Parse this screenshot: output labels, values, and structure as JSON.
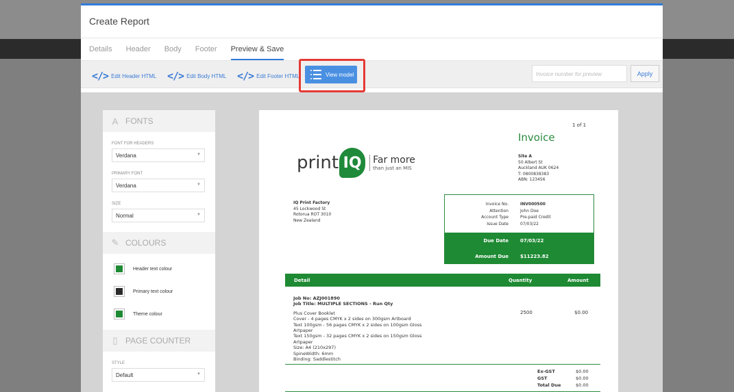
{
  "modal": {
    "title": "Create Report",
    "tabs": [
      {
        "label": "Details"
      },
      {
        "label": "Header"
      },
      {
        "label": "Body"
      },
      {
        "label": "Footer"
      },
      {
        "label": "Preview & Save",
        "active": true
      }
    ]
  },
  "toolbar": {
    "edit_header": "Edit Header HTML",
    "edit_body": "Edit Body HTML",
    "edit_footer": "Edit Footer HTML",
    "view_model": "View model",
    "invoice_placeholder": "Invoice number for preview",
    "apply": "Apply"
  },
  "panel": {
    "fonts_title": "FONTS",
    "font_headers_label": "FONT FOR HEADERS",
    "font_headers_value": "Verdana",
    "primary_font_label": "PRIMARY FONT",
    "primary_font_value": "Verdana",
    "size_label": "SIZE",
    "size_value": "Normal",
    "colours_title": "COLOURS",
    "colours": [
      {
        "label": "Header text colour",
        "color": "#1e8a33"
      },
      {
        "label": "Primary text colour",
        "color": "#2b2b2b"
      },
      {
        "label": "Theme colour",
        "color": "#1e8a33"
      }
    ],
    "page_counter_title": "PAGE COUNTER",
    "style_label": "STYLE",
    "style_value": "Default"
  },
  "document": {
    "page_number": "1 of 1",
    "title": "Invoice",
    "logo": {
      "print": "print",
      "iq": "IQ",
      "tagline_big": "Far more",
      "tagline_small": "than just an MIS"
    },
    "site": {
      "name": "Site A",
      "line1": "50 Albert St",
      "line2": "Auckland AUK 0624",
      "phone": "T: 0800838383",
      "abn": "ABN: 123456"
    },
    "customer": {
      "name": "IQ Print Factory",
      "line1": "45 Lockwood St",
      "line2": "Rotorua ROT 3010",
      "line3": "New Zealand"
    },
    "info": {
      "invoice_no_label": "Invoice No.",
      "invoice_no": "INV000500",
      "attention_label": "Attention",
      "attention": "John Doe",
      "account_type_label": "Account Type",
      "account_type": "Pre-paid Credit",
      "issue_date_label": "Issue Date",
      "issue_date": "07/03/22",
      "due_date_label": "Due Date",
      "due_date": "07/03/22",
      "amount_due_label": "Amount Due",
      "amount_due": "$11223.82"
    },
    "table": {
      "col_detail": "Detail",
      "col_quantity": "Quantity",
      "col_amount": "Amount"
    },
    "job": {
      "job_no": "Job No:   AZJ001890",
      "job_title": "Job Title: MULTIPLE SECTIONS - Run Qty",
      "lines": [
        "Plus Cover Booklet",
        "Cover - 4 pages CMYK x 2 sides on 300gsm Artboard",
        "Text 100gsm - 56 pages CMYK x 2 sides on 100gsm Gloss",
        "Artpaper",
        "Text 150gsm - 32 pages CMYK x 2 sides on 150gsm Gloss",
        "Artpaper",
        "Size: A4 (210x297)",
        "SpineWidth: 6mm",
        "Binding: Saddlestitch"
      ],
      "quantity": "2500",
      "amount": "$0.00"
    },
    "totals": {
      "ex_gst_label": "Ex-GST",
      "ex_gst": "$0.00",
      "gst_label": "GST",
      "gst": "$0.00",
      "total_due_label": "Total Due",
      "total_due": "$0.00"
    }
  }
}
